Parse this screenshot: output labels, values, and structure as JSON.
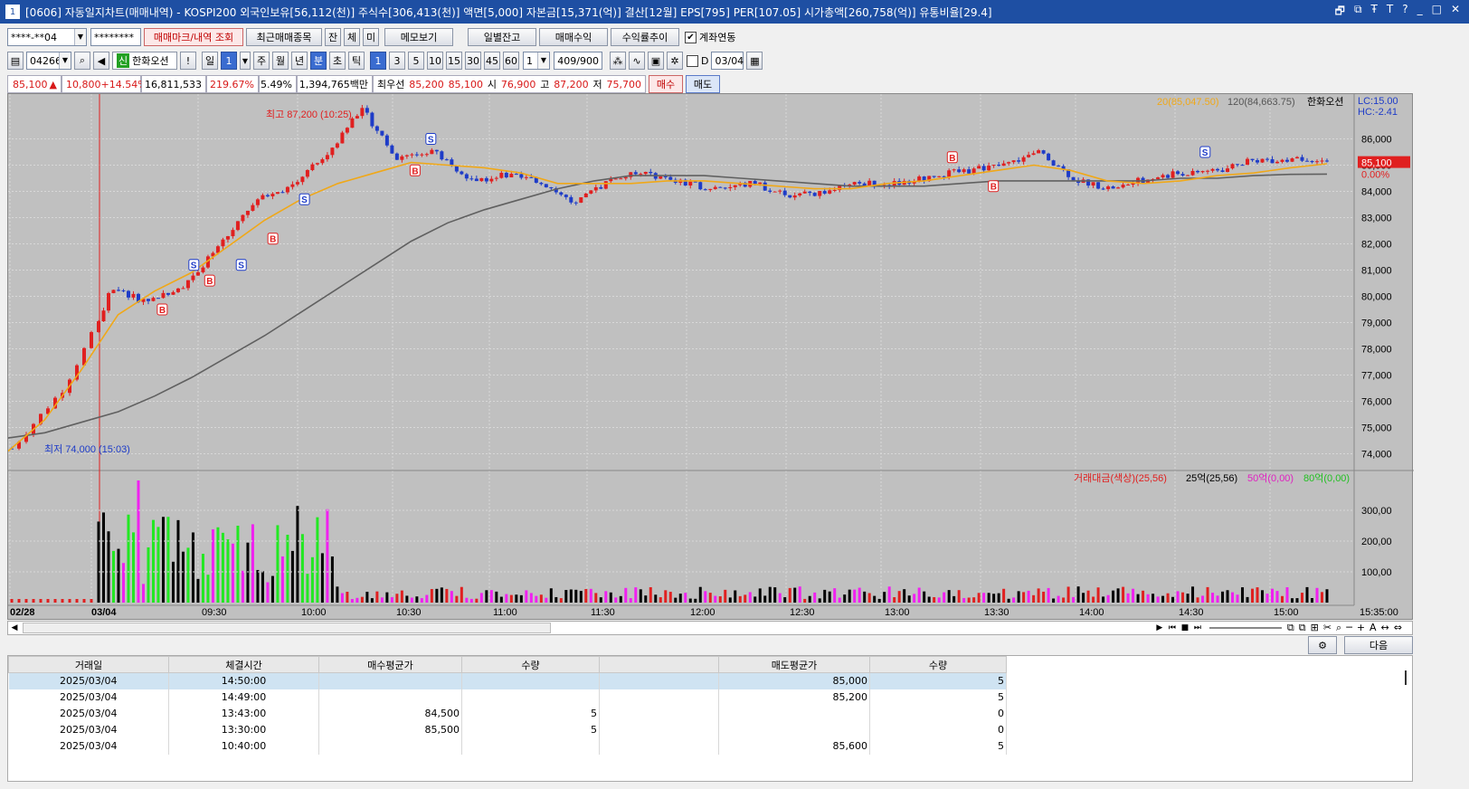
{
  "window": {
    "title": "[0606] 자동일지차트(매매내역) - KOSPI200 외국인보유[56,112(천)] 주식수[306,413(천)] 액면[5,000] 자본금[15,371(억)] 결산[12월] EPS[795] PER[107.05] 시가총액[260,758(억)] 유통비율[29.4]",
    "number": "1",
    "buttons": [
      "🗗",
      "⧉",
      "Ŧ",
      "T",
      "?",
      "_",
      "□",
      "✕"
    ]
  },
  "toolbar1": {
    "account": "****-**04",
    "password": "********",
    "trade_mark_btn": "매매마크/내역 조회",
    "recent_btn": "최근매매종목",
    "tab_jan": "잔",
    "tab_che": "체",
    "tab_mi": "미",
    "memo_btn": "메모보기",
    "daily_balance_btn": "일별잔고",
    "trade_profit_btn": "매매수익",
    "return_trend_btn": "수익률추이",
    "account_link_label": "계좌연동",
    "account_link_checked": "✔"
  },
  "toolbar2": {
    "code": "042660",
    "badge": "신",
    "stock_name": "한화오션",
    "excl": "!",
    "il": "일",
    "period": "1",
    "ju": "주",
    "wol": "월",
    "nyeon": "년",
    "bun": "분",
    "cho": "초",
    "tik": "틱",
    "intervals": [
      "1",
      "3",
      "5",
      "10",
      "15",
      "30",
      "45",
      "60"
    ],
    "n": "1",
    "count": "409",
    "total": "/900",
    "d_label": "D",
    "date": "03/04"
  },
  "quote": {
    "price": "85,100",
    "arrow": "▲",
    "change": "10,800",
    "pct": "+14.54%",
    "volume": "16,811,533",
    "vol_ratio": "219.67%",
    "turnover": "5.49%",
    "amount": "1,394,765백만",
    "best_ask_label": "최우선",
    "best_ask": "85,200",
    "best_bid": "85,100",
    "open_label": "시",
    "open": "76,900",
    "high_label": "고",
    "high": "87,200",
    "low_label": "저",
    "low": "75,700",
    "buy_btn": "매수",
    "sell_btn": "매도"
  },
  "chart": {
    "legend_ma20": "20(85,047.50)",
    "legend_ma120": "120(84,663.75)",
    "legend_name": "한화오션",
    "lc": "LC:15.00",
    "hc": "HC:-2.41",
    "price_tag": "85,100",
    "pct_tag": "0.00%",
    "high_note": "최고 87,200 (10:25)",
    "low_note": "최저 74,000 (15:03)",
    "vol_legend1": "거래대금(색상)(25,56)",
    "vol_legend2": "25억(25,56)",
    "vol_legend3": "50억(0,00)",
    "vol_legend4": "80억(0,00)",
    "end_time": "15:35:00",
    "colors": {
      "up": "#e02020",
      "down": "#1e3cc8",
      "ma20": "#f0a818",
      "ma120": "#606060",
      "bg": "#c0c0c0"
    }
  },
  "chart_data": {
    "type": "candlestick",
    "title": "한화오션",
    "x_labels": [
      "02/28",
      "03/04",
      "09:30",
      "10:00",
      "10:30",
      "11:00",
      "11:30",
      "12:00",
      "12:30",
      "13:00",
      "13:30",
      "14:00",
      "14:30",
      "15:00"
    ],
    "y_ticks": [
      "86,000",
      "85,000",
      "84,000",
      "83,000",
      "82,000",
      "81,000",
      "80,000",
      "79,000",
      "78,000",
      "77,000",
      "76,000",
      "75,000",
      "74,000"
    ],
    "y_range": [
      73500,
      87500
    ],
    "vol_ticks": [
      "300,00",
      "200,00",
      "100,00"
    ],
    "series": [
      {
        "name": "20",
        "values": [
          74100,
          75300,
          77200,
          79300,
          80200,
          80900,
          81900,
          82900,
          83700,
          84300,
          84700,
          85100,
          85000,
          84900,
          84700,
          84300,
          84300,
          84300,
          84400,
          84400,
          84300,
          84200,
          84100,
          84100,
          84300,
          84400,
          84600,
          84800,
          85000,
          84800,
          84400,
          84300,
          84400,
          84600,
          84700,
          84900,
          85050
        ]
      },
      {
        "name": "120",
        "values": [
          74600,
          74800,
          75200,
          75600,
          76200,
          76900,
          77700,
          78500,
          79400,
          80300,
          81200,
          82100,
          82800,
          83300,
          83700,
          84100,
          84400,
          84600,
          84600,
          84600,
          84500,
          84400,
          84300,
          84200,
          84200,
          84200,
          84300,
          84400,
          84400,
          84400,
          84400,
          84400,
          84500,
          84500,
          84600,
          84650,
          84660
        ]
      },
      {
        "name": "price",
        "values": [
          74200,
          76500,
          80300,
          79800,
          80400,
          81800,
          83600,
          84200,
          85300,
          87200,
          85300,
          85600,
          84400,
          84600,
          84400,
          83500,
          84500,
          84700,
          84300,
          84100,
          84300,
          83800,
          84000,
          84300,
          84300,
          84600,
          84800,
          85000,
          85500,
          84400,
          84100,
          84500,
          84700,
          84800,
          85200,
          85200,
          85100
        ]
      }
    ],
    "markers": [
      {
        "type": "B",
        "x": "09:20",
        "price": 79500
      },
      {
        "type": "S",
        "x": "09:30",
        "price": 81200
      },
      {
        "type": "B",
        "x": "09:35",
        "price": 80600
      },
      {
        "type": "S",
        "x": "09:45",
        "price": 81200
      },
      {
        "type": "B",
        "x": "09:55",
        "price": 82200
      },
      {
        "type": "S",
        "x": "10:05",
        "price": 83700
      },
      {
        "type": "B",
        "x": "10:40",
        "price": 84800
      },
      {
        "type": "S",
        "x": "10:45",
        "price": 86000
      },
      {
        "type": "B",
        "x": "13:30",
        "price": 85300
      },
      {
        "type": "B",
        "x": "13:43",
        "price": 84200
      },
      {
        "type": "S",
        "x": "14:50",
        "price": 85500
      }
    ]
  },
  "table": {
    "headers": [
      "거래일",
      "체결시간",
      "매수평균가",
      "수량",
      "",
      "매도평균가",
      "수량"
    ],
    "rows": [
      [
        "2025/03/04",
        "14:50:00",
        "",
        "",
        "",
        "85,000",
        "5"
      ],
      [
        "2025/03/04",
        "14:49:00",
        "",
        "",
        "",
        "85,200",
        "5"
      ],
      [
        "2025/03/04",
        "13:43:00",
        "84,500",
        "5",
        "",
        "",
        "0"
      ],
      [
        "2025/03/04",
        "13:30:00",
        "85,500",
        "5",
        "",
        "",
        "0"
      ],
      [
        "2025/03/04",
        "10:40:00",
        "",
        "",
        "",
        "85,600",
        "5"
      ]
    ],
    "next_btn": "다음"
  }
}
